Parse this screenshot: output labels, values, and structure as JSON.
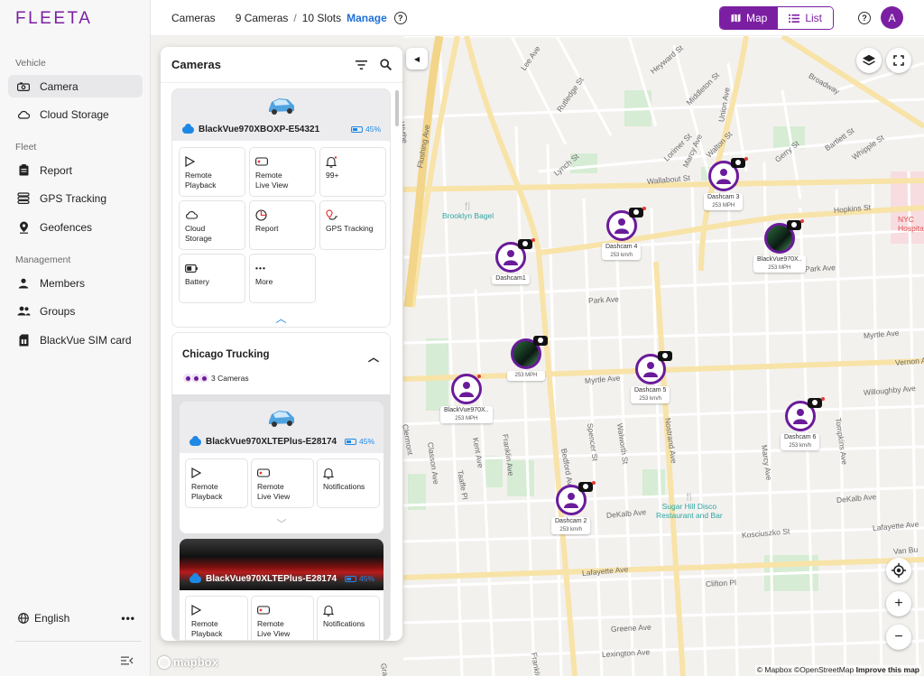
{
  "sidebar": {
    "logo": "FLEETA",
    "sections": {
      "vehicle": "Vehicle",
      "fleet": "Fleet",
      "management": "Management"
    },
    "items": {
      "camera": "Camera",
      "cloud_storage": "Cloud Storage",
      "report": "Report",
      "gps_tracking": "GPS Tracking",
      "geofences": "Geofences",
      "members": "Members",
      "groups": "Groups",
      "sim_card": "BlackVue SIM card"
    },
    "language": "English",
    "more": "•••"
  },
  "topbar": {
    "title": "Cameras",
    "cameras_count": "9 Cameras",
    "separator": "/",
    "slots_count": "10 Slots",
    "manage": "Manage",
    "help": "?",
    "map_label": "Map",
    "list_label": "List",
    "avatar_initial": "A"
  },
  "panel": {
    "title": "Cameras",
    "camera1": {
      "name": "BlackVue970XBOXP-E54321",
      "battery": "45%",
      "tiles": [
        {
          "line1": "Remote",
          "line2": "Playback"
        },
        {
          "line1": "Remote",
          "line2": "Live View"
        },
        {
          "line1": "99+",
          "line2": ""
        },
        {
          "line1": "Cloud",
          "line2": "Storage"
        },
        {
          "line1": "Report",
          "line2": ""
        },
        {
          "line1": "GPS Tracking",
          "line2": ""
        },
        {
          "line1": "Battery",
          "line2": ""
        },
        {
          "line1": "More",
          "line2": ""
        }
      ]
    },
    "group": {
      "name": "Chicago Trucking",
      "count": "3 Cameras",
      "cam_a": {
        "name": "BlackVue970XLTEPlus-E28174",
        "battery": "45%",
        "tiles": [
          {
            "line1": "Remote",
            "line2": "Playback"
          },
          {
            "line1": "Remote",
            "line2": "Live View"
          },
          {
            "line1": "Notifications",
            "line2": ""
          }
        ]
      },
      "cam_b": {
        "name": "BlackVue970XLTEPlus-E28174",
        "battery": "45%",
        "tiles": [
          {
            "line1": "Remote",
            "line2": "Playback"
          },
          {
            "line1": "Remote",
            "line2": "Live View"
          },
          {
            "line1": "Notifications",
            "line2": ""
          }
        ]
      }
    }
  },
  "map": {
    "streets": {
      "lee_ave": "Lee Ave",
      "rutledge": "Rutledge St",
      "heyward": "Heyward St",
      "middleton": "Middleton St",
      "union": "Union Ave",
      "broadway": "Broadway",
      "lorimer": "Lorimer St",
      "marcy_ave": "Marcy Ave",
      "walton": "Walton St",
      "gerry": "Gerry St",
      "bartlett": "Bartlett St",
      "whipple": "Whipple St",
      "lynch": "Lynch St",
      "wallabout": "Wallabout St",
      "hopkins": "Hopkins St",
      "flushing": "Flushing Ave",
      "park_ave_a": "Park Ave",
      "park_ave_b": "Park Ave",
      "myrtle_a": "Myrtle Ave",
      "myrtle_b": "Myrtle Ave",
      "willoughby": "Willoughby Ave",
      "vernon": "Vernon Ave",
      "kent": "Kent Ave",
      "franklin": "Franklin Ave",
      "bedford": "Bedford Ave",
      "spencer": "Spencer St",
      "walworth": "Walworth St",
      "nostrand": "Nostrand Ave",
      "marcy_b": "Marcy Ave",
      "tompkins": "Tompkins Ave",
      "classon": "Classon Ave",
      "taaffe": "Taaffe Pl",
      "dekalb_a": "DeKalb Ave",
      "dekalb_b": "DeKalb Ave",
      "kosciuszko": "Kosciuszko St",
      "lafayette_a": "Lafayette Ave",
      "lafayette_b": "Lafayette Ave",
      "clifton": "Clifton Pl",
      "greene": "Greene Ave",
      "lexington": "Lexington Ave",
      "van_buren": "Van Bu",
      "wythe": "Wythe",
      "clermont": "Clermont",
      "gra": "Gra",
      "franklin_b": "Franklin"
    },
    "pois": {
      "brooklyn_bagel": "Brooklyn Bagel",
      "sugar_hill_1": "Sugar Hill Disco",
      "sugar_hill_2": "Restaurant and Bar",
      "nyc_1": "NYC",
      "nyc_2": "Hospital"
    },
    "markers": [
      {
        "label": "Dashcam1",
        "speed": ""
      },
      {
        "label": "Dashcam 4",
        "speed": "253 km/h"
      },
      {
        "label": "Dashcam 3",
        "speed": "253 MPH"
      },
      {
        "label": "BlackVue970X..",
        "speed": "253 MPH"
      },
      {
        "label": "",
        "speed": "253 MPH"
      },
      {
        "label": "BlackVue970X..",
        "speed": "253 MPH"
      },
      {
        "label": "Dashcam 5",
        "speed": "253 km/h"
      },
      {
        "label": "Dashcam 6",
        "speed": "253 km/h"
      },
      {
        "label": "Dashcam 2",
        "speed": "253 km/h"
      }
    ],
    "attribution_1": "© Mapbox ©OpenStreetMap",
    "attribution_2": "Improve this map",
    "mapbox_logo": "mapbox",
    "zoom_in": "+",
    "zoom_out": "−"
  },
  "colors": {
    "brand": "#7b1fa2",
    "link": "#1e6fd9",
    "battery": "#1e88e5"
  }
}
